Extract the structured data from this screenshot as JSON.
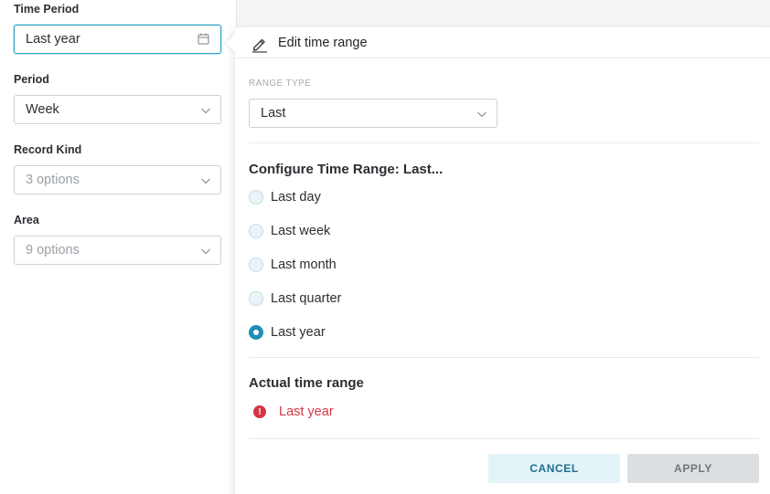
{
  "filters": {
    "time_period": {
      "label": "Time Period",
      "value": "Last year"
    },
    "period": {
      "label": "Period",
      "value": "Week"
    },
    "record_kind": {
      "label": "Record Kind",
      "value": "3 options"
    },
    "area": {
      "label": "Area",
      "value": "9 options"
    }
  },
  "popover": {
    "title": "Edit time range",
    "range_type_label": "RANGE TYPE",
    "range_type_value": "Last",
    "configure_title": "Configure Time Range: Last...",
    "options": [
      {
        "label": "Last day",
        "checked": false
      },
      {
        "label": "Last week",
        "checked": false
      },
      {
        "label": "Last month",
        "checked": false
      },
      {
        "label": "Last quarter",
        "checked": false
      },
      {
        "label": "Last year",
        "checked": true
      }
    ],
    "actual_title": "Actual time range",
    "actual_value": "Last year",
    "cancel_label": "CANCEL",
    "apply_label": "APPLY"
  },
  "icons": {
    "pencil": "pencil-icon",
    "calendar": "calendar-icon",
    "chevron": "chevron-down-icon",
    "error": "error-icon"
  },
  "colors": {
    "accent": "#1f8fb5",
    "error": "#d63545",
    "focus": "#2aa3c4"
  }
}
